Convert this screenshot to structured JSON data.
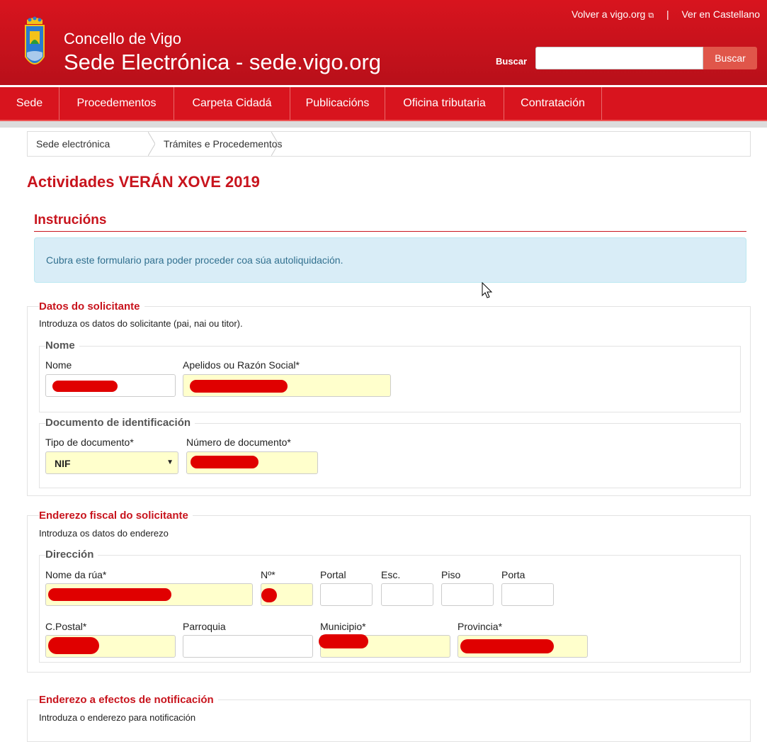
{
  "header": {
    "top_links": {
      "back": "Volver a vigo.org",
      "castellano": "Ver en Castellano",
      "separator": "|"
    },
    "org": "Concello de Vigo",
    "site": "Sede Electrónica - sede.vigo.org",
    "search": {
      "label": "Buscar",
      "value": "",
      "button": "Buscar"
    }
  },
  "nav": {
    "items": [
      "Sede",
      "Procedementos",
      "Carpeta Cidadá",
      "Publicacións",
      "Oficina tributaria",
      "Contratación"
    ]
  },
  "breadcrumb": [
    "Sede electrónica",
    "Trámites e Procedementos"
  ],
  "page_title": "Actividades VERÁN XOVE 2019",
  "instructions": {
    "title": "Instrucións",
    "text": "Cubra este formulario para poder proceder coa súa autoliquidación."
  },
  "solicitante": {
    "legend": "Datos do solicitante",
    "help": "Introduza os datos do solicitante (pai, nai ou titor).",
    "nome": {
      "legend": "Nome",
      "nome_label": "Nome",
      "apelidos_label": "Apelidos ou Razón Social*"
    },
    "documento": {
      "legend": "Documento de identificación",
      "tipo_label": "Tipo de documento*",
      "tipo_value": "NIF",
      "numero_label": "Número de documento*"
    }
  },
  "enderezo_fiscal": {
    "legend": "Enderezo fiscal do solicitante",
    "help": "Introduza os datos do enderezo",
    "direccion": {
      "legend": "Dirección",
      "rua_label": "Nome da rúa*",
      "numero_label": "Nº*",
      "portal_label": "Portal",
      "esc_label": "Esc.",
      "piso_label": "Piso",
      "porta_label": "Porta",
      "cpostal_label": "C.Postal*",
      "parroquia_label": "Parroquia",
      "municipio_label": "Municipio*",
      "provincia_label": "Provincia*"
    }
  },
  "enderezo_notificacion": {
    "legend": "Enderezo a efectos de notificación",
    "help": "Introduza o enderezo para notificación"
  },
  "colors": {
    "brand_red": "#d8141e",
    "heading_red": "#c8141d",
    "required_bg": "#ffffcc",
    "alert_bg": "#d9edf7"
  }
}
